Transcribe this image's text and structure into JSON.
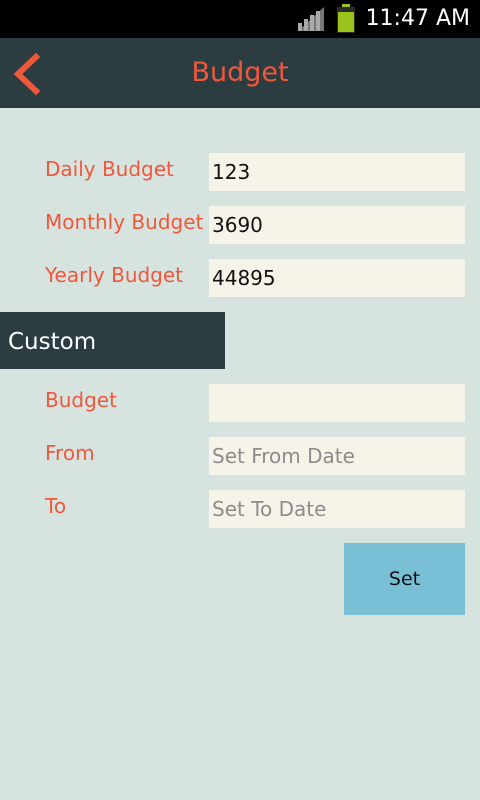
{
  "status_bar": {
    "time": "11:47 AM"
  },
  "app_bar": {
    "title": "Budget"
  },
  "budget_fields": [
    {
      "label": "Daily Budget",
      "value": "123"
    },
    {
      "label": "Monthly Budget",
      "value": "3690"
    },
    {
      "label": "Yearly Budget",
      "value": "44895"
    }
  ],
  "custom": {
    "header": "Custom",
    "budget": {
      "label": "Budget",
      "value": "",
      "placeholder": ""
    },
    "from": {
      "label": "From",
      "value": "",
      "placeholder": "Set From Date"
    },
    "to": {
      "label": "To",
      "value": "",
      "placeholder": "Set To Date"
    },
    "set_button": "Set"
  },
  "colors": {
    "background": "#d6e3df",
    "app_bar": "#2b3d41",
    "accent": "#f0583c",
    "field_bg": "#f6f3e9",
    "button": "#79bfd6"
  },
  "icons": [
    "signal-icon",
    "battery-icon",
    "back-arrow-icon"
  ]
}
